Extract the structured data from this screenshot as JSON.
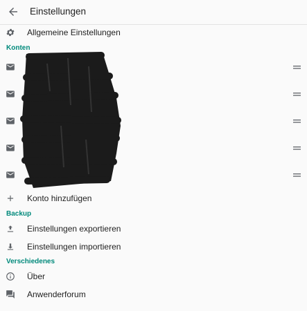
{
  "appbar": {
    "title": "Einstellungen",
    "back_icon": "arrow-back-icon"
  },
  "general": {
    "label": "Allgemeine Einstellungen",
    "icon": "gear-icon"
  },
  "sections": {
    "accounts": "Konten",
    "backup": "Backup",
    "misc": "Verschiedenes"
  },
  "accounts": [
    {
      "icon": "mail-icon",
      "handle_icon": "drag-handle-icon"
    },
    {
      "icon": "mail-icon",
      "handle_icon": "drag-handle-icon"
    },
    {
      "icon": "mail-icon",
      "handle_icon": "drag-handle-icon"
    },
    {
      "icon": "mail-icon",
      "handle_icon": "drag-handle-icon"
    },
    {
      "icon": "mail-icon",
      "handle_icon": "drag-handle-icon"
    }
  ],
  "add_account": {
    "label": "Konto hinzufügen",
    "icon": "plus-icon"
  },
  "backup_items": {
    "export": "Einstellungen exportieren",
    "import": "Einstellungen importieren"
  },
  "misc_items": {
    "about": "Über",
    "forum": "Anwenderforum"
  },
  "colors": {
    "accent": "#00897b",
    "icon": "#5f6368",
    "text": "#212121",
    "background": "#fafafa"
  }
}
